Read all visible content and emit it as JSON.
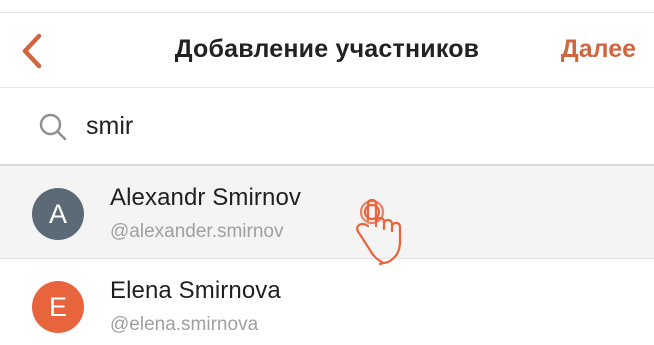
{
  "header": {
    "title": "Добавление участников",
    "next_label": "Далее",
    "back_icon": "chevron-left-icon",
    "accent_color": "#d0663f"
  },
  "search": {
    "value": "smir",
    "icon": "search-icon"
  },
  "results": [
    {
      "initial": "A",
      "name": "Alexandr Smirnov",
      "handle": "@alexander.smirnov",
      "avatar_color": "#5b6a76"
    },
    {
      "initial": "E",
      "name": "Elena Smirnova",
      "handle": "@elena.smirnova",
      "avatar_color": "#e8643c"
    }
  ],
  "gesture_icon": "tap-hand-icon"
}
